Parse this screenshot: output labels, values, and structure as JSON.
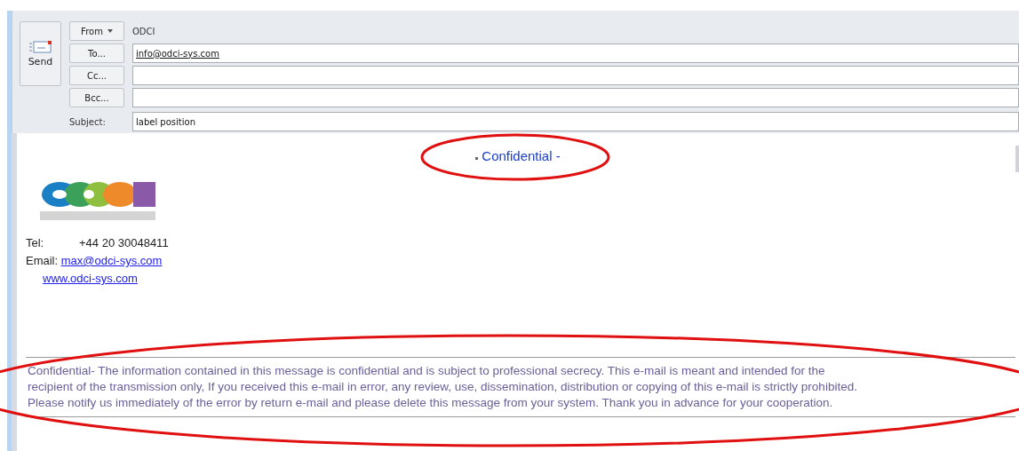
{
  "send_button": {
    "label": "Send"
  },
  "header_fields": [
    {
      "kind": "dropdown",
      "button": "From",
      "value": "ODCI"
    },
    {
      "kind": "recipient",
      "button": "To...",
      "value": "info@odci-sys.com"
    },
    {
      "kind": "recipient",
      "button": "Cc..."
    },
    {
      "kind": "recipient",
      "button": "Bcc..."
    },
    {
      "kind": "subject",
      "label": "Subject:",
      "value": "label position"
    }
  ],
  "body": {
    "heading": "Confidential -",
    "tel_label": "Tel:",
    "tel_value": "+44 20 30048411",
    "email_label": "Email:",
    "email_link": "max@odci-sys.com",
    "website_link": "www.odci-sys.com",
    "disclaimer_lines": [
      "Confidential- The information contained in this message is confidential and is subject to professional secrecy. This e-mail is meant and intended for the",
      "recipient of the transmission only, If you received this e-mail in error, any review, use, dissemination, distribution or copying of this e-mail is strictly prohibited.",
      "Please notify us immediately of the error by return e-mail and please delete this message from your system. Thank you in advance for your cooperation."
    ]
  }
}
